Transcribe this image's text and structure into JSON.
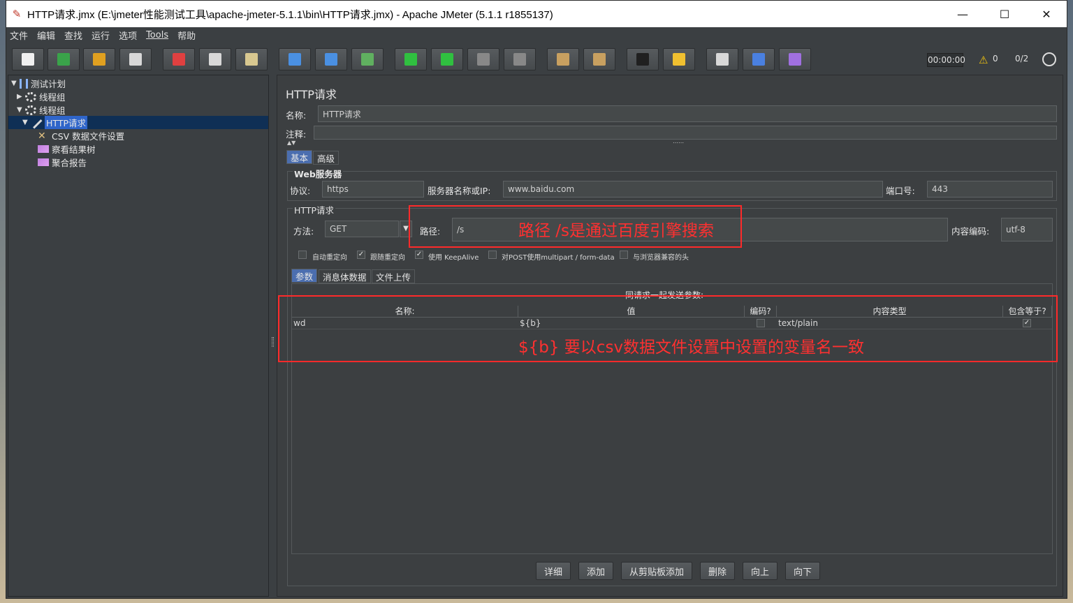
{
  "window": {
    "title": "HTTP请求.jmx (E:\\jmeter性能测试工具\\apache-jmeter-5.1.1\\bin\\HTTP请求.jmx) - Apache JMeter (5.1.1 r1855137)",
    "minimize": "—",
    "maximize": "☐",
    "close": "✕"
  },
  "menu": [
    "文件",
    "编辑",
    "查找",
    "运行",
    "选项",
    "Tools",
    "帮助"
  ],
  "toolbar": {
    "timer": "00:00:00",
    "warning_count": "0",
    "threads": "0/2",
    "buttons": [
      {
        "name": "new-icon",
        "color": "#f0f0f0"
      },
      {
        "name": "templates-icon",
        "color": "#3aa34a"
      },
      {
        "name": "open-icon",
        "color": "#e0a020"
      },
      {
        "name": "save-icon",
        "color": "#d8d8d8"
      },
      {
        "name": "cut-icon",
        "color": "#e04040"
      },
      {
        "name": "copy-icon",
        "color": "#d8d8d8"
      },
      {
        "name": "paste-icon",
        "color": "#d8c890"
      },
      {
        "name": "expand-icon",
        "color": "#4a90e2"
      },
      {
        "name": "collapse-icon",
        "color": "#4a90e2"
      },
      {
        "name": "toggle-icon",
        "color": "#60b060"
      },
      {
        "name": "start-icon",
        "color": "#30c040"
      },
      {
        "name": "start-no-pause-icon",
        "color": "#30c040"
      },
      {
        "name": "stop-icon",
        "color": "#888888"
      },
      {
        "name": "shutdown-icon",
        "color": "#888888"
      },
      {
        "name": "clear-icon",
        "color": "#c8a060"
      },
      {
        "name": "clear-all-icon",
        "color": "#c8a060"
      },
      {
        "name": "search-icon",
        "color": "#202020"
      },
      {
        "name": "reset-search-icon",
        "color": "#f0c030"
      },
      {
        "name": "function-helper-icon",
        "color": "#d8d8d8"
      },
      {
        "name": "help-icon",
        "color": "#4a80e0"
      },
      {
        "name": "remote-icon",
        "color": "#a070e0"
      }
    ]
  },
  "tree": {
    "items": [
      {
        "label": "测试计划",
        "toggle": "▼",
        "icon": "test-plan-icon"
      },
      {
        "label": "线程组",
        "toggle": "▶",
        "icon": "gear-icon"
      },
      {
        "label": "线程组",
        "toggle": "▼",
        "icon": "gear-icon"
      },
      {
        "label": "HTTP请求",
        "toggle": "▼",
        "icon": "pipette-icon"
      },
      {
        "label": "CSV 数据文件设置",
        "toggle": "",
        "icon": "wrench-icon"
      },
      {
        "label": "察看结果树",
        "toggle": "",
        "icon": "chart-icon"
      },
      {
        "label": "聚合报告",
        "toggle": "",
        "icon": "chart-icon"
      }
    ]
  },
  "panel": {
    "title": "HTTP请求",
    "name_label": "名称:",
    "name_value": "HTTP请求",
    "comment_label": "注释:",
    "tabs": [
      "基本",
      "高级"
    ],
    "web_server": {
      "title": "Web服务器",
      "protocol_label": "协议:",
      "protocol": "https",
      "server_label": "服务器名称或IP:",
      "server": "www.baidu.com",
      "port_label": "端口号:",
      "port": "443"
    },
    "http_request": {
      "title": "HTTP请求",
      "method_label": "方法:",
      "method": "GET",
      "path_label": "路径:",
      "path": "/s",
      "encoding_label": "内容编码:",
      "encoding": "utf-8",
      "options": [
        {
          "label": "自动重定向",
          "checked": false
        },
        {
          "label": "跟随重定向",
          "checked": true
        },
        {
          "label": "使用 KeepAlive",
          "checked": true
        },
        {
          "label": "对POST使用multipart / form-data",
          "checked": false
        },
        {
          "label": "与浏览器兼容的头",
          "checked": false
        }
      ]
    },
    "subtabs": [
      "参数",
      "消息体数据",
      "文件上传"
    ],
    "params_caption": "同请求一起发送参数:",
    "columns": [
      "名称:",
      "值",
      "编码?",
      "内容类型",
      "包含等于?"
    ],
    "rows": [
      {
        "name": "wd",
        "value": "${b}",
        "encode": false,
        "content_type": "text/plain",
        "include_equals": true
      }
    ],
    "buttons": [
      "详细",
      "添加",
      "从剪贴板添加",
      "删除",
      "向上",
      "向下"
    ]
  },
  "annotations": {
    "path_note": "路径 /s是通过百度引擎搜索",
    "param_note": "${b}  要以csv数据文件设置中设置的变量名一致"
  }
}
